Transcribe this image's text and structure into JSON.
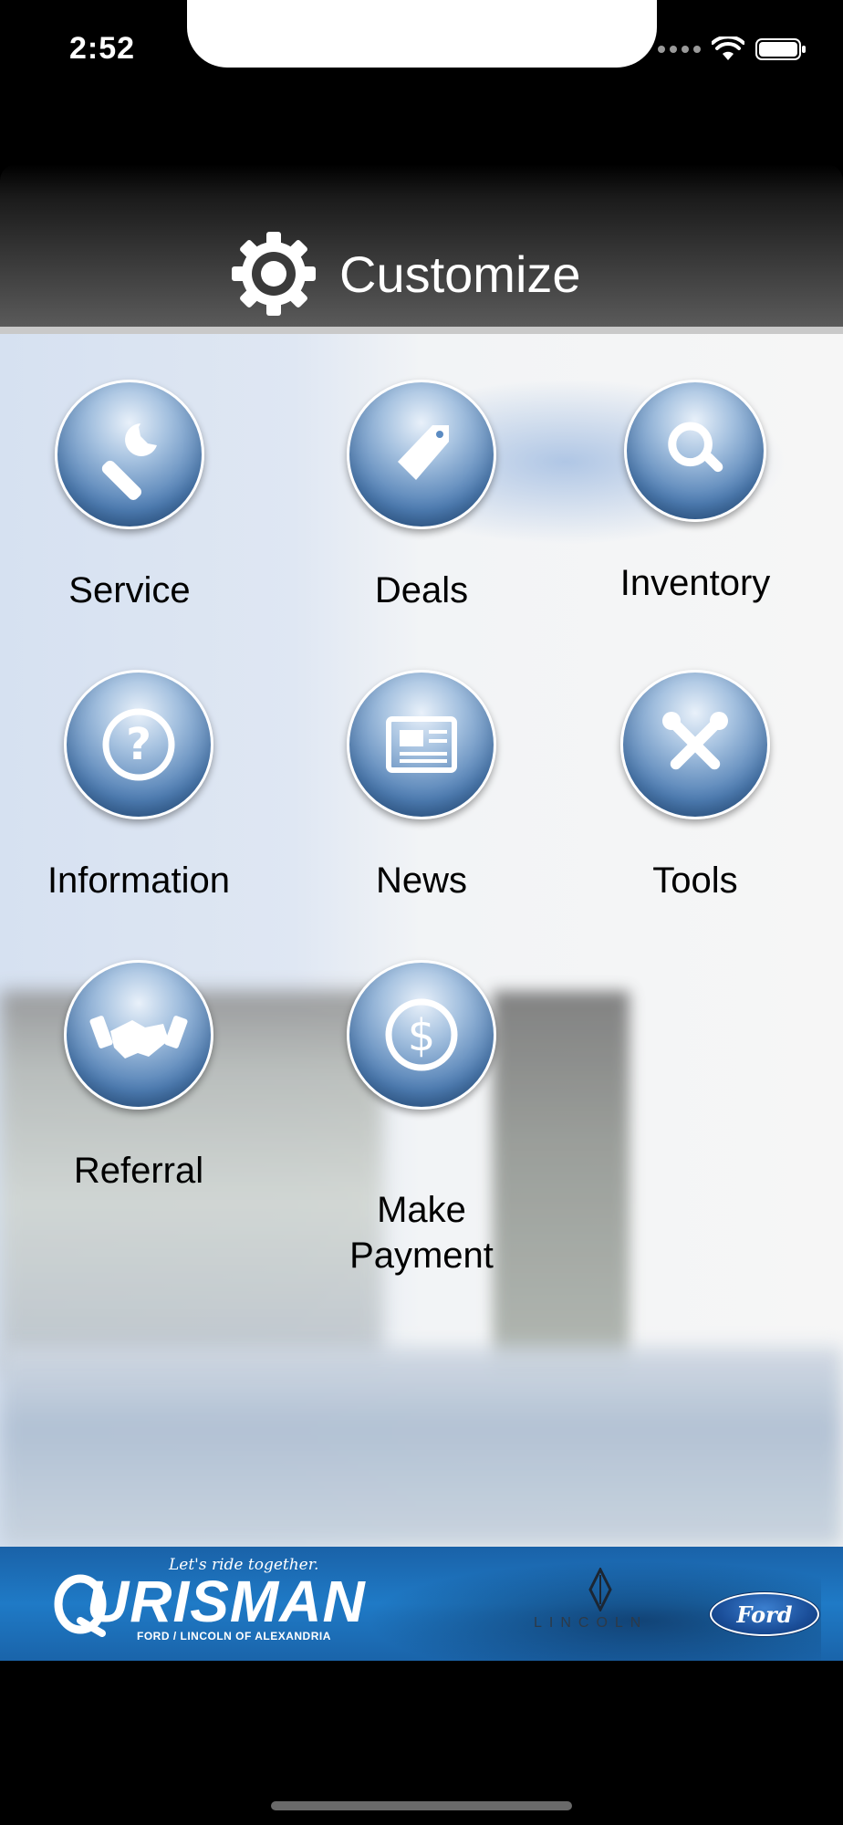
{
  "status_bar": {
    "time": "2:52"
  },
  "header": {
    "title": "Customize",
    "icon": "gear-icon"
  },
  "tiles": [
    {
      "label": "Service",
      "icon": "wrench-icon"
    },
    {
      "label": "Deals",
      "icon": "price-tag-icon"
    },
    {
      "label": "Inventory",
      "icon": "magnifier-icon"
    },
    {
      "label": "Information",
      "icon": "question-icon"
    },
    {
      "label": "News",
      "icon": "newspaper-icon"
    },
    {
      "label": "Tools",
      "icon": "tools-icon"
    },
    {
      "label": "Referral",
      "icon": "handshake-icon"
    },
    {
      "label_line1": "Make",
      "label_line2": "Payment",
      "icon": "dollar-icon"
    }
  ],
  "footer": {
    "tagline": "Let's ride together.",
    "brand": "URISMAN",
    "brand_sub": "FORD / LINCOLN OF ALEXANDRIA",
    "lincoln": "LINCOLN",
    "ford": "Ford"
  },
  "colors": {
    "tile_blue": "#4d7cb2",
    "header_dark": "#3a3a3a",
    "footer_blue": "#1f7ac6"
  }
}
